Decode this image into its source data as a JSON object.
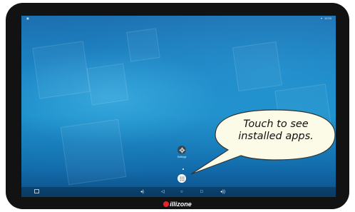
{
  "status_bar": {
    "left_text": "▣",
    "time": "12:00"
  },
  "home": {
    "settings_app_label": "Settings",
    "icons": {
      "settings": "gear-icon",
      "all_apps": "grid-icon"
    }
  },
  "callout": {
    "line1": "Touch to see",
    "line2": "installed apps."
  },
  "nav_bar": {
    "icons": [
      "screenshot-icon",
      "volume-down-icon",
      "back-icon",
      "home-icon",
      "recents-icon",
      "volume-up-icon"
    ]
  },
  "brand": {
    "name": "illizone",
    "color": "#e3262b"
  },
  "colors": {
    "bezel": "#121212",
    "wallpaper_top": "#1d6fb0",
    "wallpaper_bottom": "#0c4f86",
    "bubble_fill": "#fbfbe8"
  }
}
